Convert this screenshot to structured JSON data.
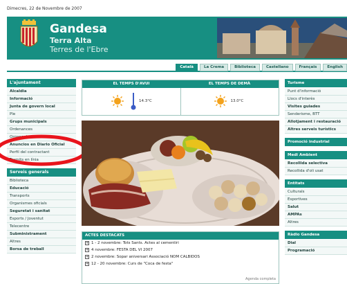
{
  "date": "Dimecres, 22 de Novembre de 2007",
  "header": {
    "title": "Gandesa",
    "subtitle1": "Terra Alta",
    "subtitle2": "Terres de l'Ebre"
  },
  "languages": [
    {
      "label": "Català",
      "active": true
    },
    {
      "label": "La Crema",
      "active": false
    },
    {
      "label": "Biblioteca",
      "active": false
    },
    {
      "label": "Castellano",
      "active": false
    },
    {
      "label": "Français",
      "active": false
    },
    {
      "label": "English",
      "active": false
    }
  ],
  "left": {
    "block1_title": "L'ajuntament",
    "block1_items": [
      "Alcaldia",
      "Informació",
      "Junta de govern local",
      "Ple",
      "Grups municipals",
      "Ordenances",
      "Organs de govern",
      "Anuncios en Diario Oficial",
      "Perfil del contractant",
      "Tramits en línia"
    ],
    "block2_title": "Serveis generals",
    "block2_items": [
      "Biblioteca",
      "Educació",
      "Transports",
      "Organismes oficials",
      "Seguretat i sanitat",
      "Esports / Joventut",
      "Telecentre",
      "Subministrament",
      "Altres",
      "Borsa de treball"
    ]
  },
  "weather": {
    "today_label": "EL TEMPS D'AVUI",
    "tomorrow_label": "EL TEMPS DE DEMÀ",
    "today_temp": "14.3°C",
    "tomorrow_temp": "13.0°C"
  },
  "news": {
    "title": "ACTES DESTACATS",
    "items": [
      "1 - 2 novembre: Tots Sants. Actes al cementiri",
      "4 novembre: FESTA DEL VI 2007",
      "2 novembre: Sopar aniversari Associació NOM CALBIDOS",
      "12 - 20 novembre: Curs de \"Coca de festa\""
    ],
    "more": "Agenda completa"
  },
  "right": {
    "block1_title": "Turisme",
    "block1_items": [
      "Punt d'informació",
      "Llocs d'interès",
      "Visites guiades",
      "Senderisme, BTT",
      "Allotjament i restauració",
      "Altres serveis turístics"
    ],
    "block2_title": "Promoció industrial",
    "block3_title": "Medi Ambient",
    "block3_items": [
      "Recollida selectiva",
      "Recollida d'oli usat"
    ],
    "block4_title": "Entitats",
    "block4_items": [
      "Culturals",
      "Esportives",
      "Salut",
      "AMPAs",
      "Altres"
    ],
    "block5_title": "Ràdio Gandesa",
    "block5_items": [
      "Dial",
      "Programació"
    ]
  },
  "colors": {
    "brand": "#178f82",
    "annotation": "#e8141c"
  }
}
